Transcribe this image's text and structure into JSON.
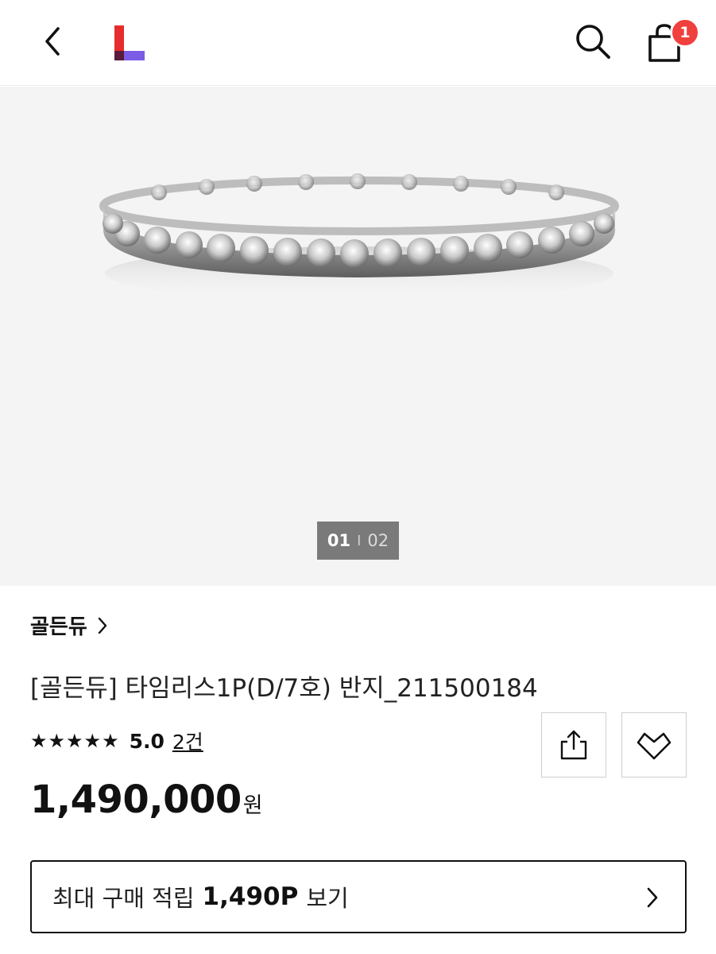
{
  "header": {
    "cart_count": "1"
  },
  "gallery": {
    "current_page": "01",
    "separator": "I",
    "total_pages": "02"
  },
  "product": {
    "brand": "골든듀",
    "title": "[골든듀] 타임리스1P(D/7호) 반지_211500184",
    "stars": "★★★★★",
    "rating": "5.0",
    "review_count": "2건",
    "price": "1,490,000",
    "price_unit": "원"
  },
  "points": {
    "prefix": "최대 구매 적립",
    "amount": "1,490P",
    "suffix": "보기"
  },
  "colors": {
    "logo_red": "#e62c2c",
    "logo_purple": "#7b5ce6",
    "badge_red": "#f0403d"
  }
}
